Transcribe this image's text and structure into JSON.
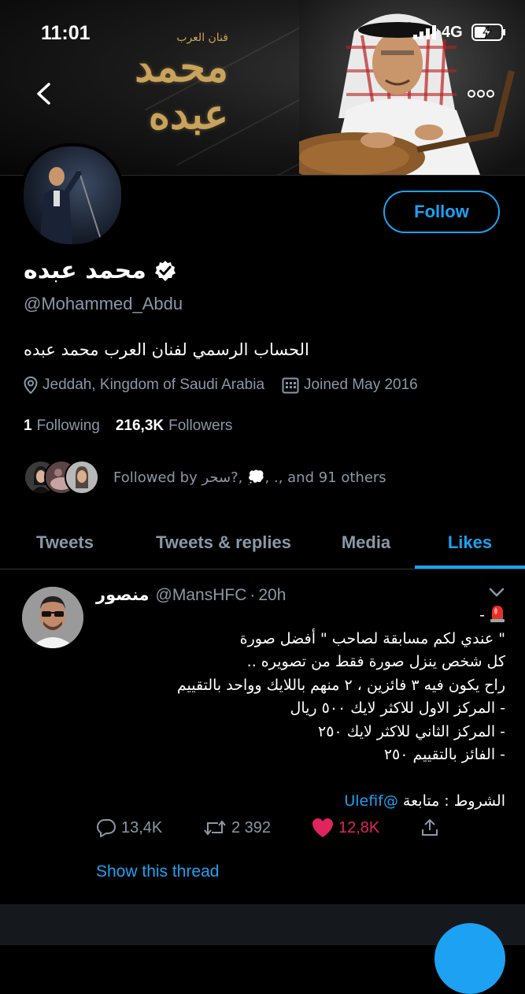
{
  "status_bar": {
    "time": "11:01",
    "network": "4G"
  },
  "banner": {
    "subtitle": "فنان العرب",
    "title": "محمد عبده"
  },
  "profile": {
    "name": "محمد عبده",
    "handle": "@Mohammed_Abdu",
    "bio": "الحساب الرسمي لفنان العرب محمد عبده",
    "location": "Jeddah, Kingdom of Saudi Arabia",
    "joined": "Joined May 2016",
    "following_count": "1",
    "following_label": "Following",
    "followers_count": "216,3K",
    "followers_label": "Followers",
    "followed_by": "Followed by سحر?, 💭, ., and 91 others",
    "follow_label": "Follow",
    "verified": true
  },
  "tabs": [
    {
      "label": "Tweets",
      "active": false
    },
    {
      "label": "Tweets & replies",
      "active": false
    },
    {
      "label": "Media",
      "active": false
    },
    {
      "label": "Likes",
      "active": true
    }
  ],
  "tweet": {
    "name": "منصور",
    "handle": "@MansHFC",
    "time": "20h",
    "lines": [
      "-",
      "\" عندي لكم مسابقة لصاحب \" أفضل صورة",
      "كل شخص ينزل صورة فقط من تصويره  ..",
      "راح يكون فيه ٣ فائزين ، ٢ منهم باللايك وواحد بالتقييم",
      "- المركز الاول للاكثر لايك ٥٠٠ ريال",
      "- المركز الثاني للاكثر لايك ٢٥٠",
      "- الفائز بالتقييم ٢٥٠"
    ],
    "conditions_label": "الشروط : متابعة",
    "mention": "@Ulefif",
    "replies": "13,4K",
    "retweets": "2 392",
    "likes": "12,8K",
    "show_thread": "Show this thread"
  },
  "colors": {
    "accent": "#1da1f2",
    "muted": "#8899a6",
    "like": "#e0245e",
    "gold": "#c9a35c",
    "background": "#000000"
  }
}
